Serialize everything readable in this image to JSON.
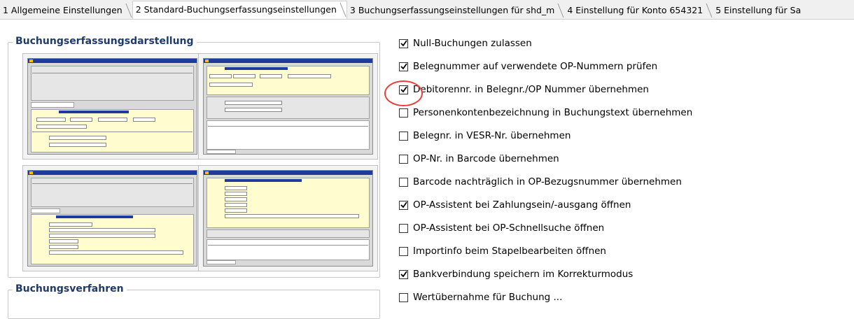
{
  "tabs": [
    {
      "label": "1 Allgemeine Einstellungen",
      "active": false
    },
    {
      "label": "2 Standard-Buchungserfassungseinstellungen",
      "active": true
    },
    {
      "label": "3 Buchungserfassungseinstellungen für shd_m",
      "active": false
    },
    {
      "label": "4 Einstellung für Konto 654321",
      "active": false
    },
    {
      "label": "5 Einstellung für Sa",
      "active": false
    }
  ],
  "left": {
    "group1_title": "Buchungserfassungsdarstellung",
    "group2_title": "Buchungsverfahren"
  },
  "options": [
    {
      "label": "Null-Buchungen zulassen",
      "checked": true
    },
    {
      "label": "Belegnummer auf verwendete OP-Nummern prüfen",
      "checked": true
    },
    {
      "label": "Debitorennr. in Belegnr./OP Nummer übernehmen",
      "checked": true
    },
    {
      "label": "Personenkontenbezeichnung in Buchungstext übernehmen",
      "checked": false
    },
    {
      "label": "Belegnr. in VESR-Nr. übernehmen",
      "checked": false
    },
    {
      "label": "OP-Nr. in Barcode übernehmen",
      "checked": false
    },
    {
      "label": "Barcode nachträglich in OP-Bezugsnummer übernehmen",
      "checked": false
    },
    {
      "label": "OP-Assistent bei Zahlungsein/-ausgang öffnen",
      "checked": true
    },
    {
      "label": "OP-Assistent bei OP-Schnellsuche öffnen",
      "checked": false
    },
    {
      "label": "Importinfo beim Stapelbearbeiten öffnen",
      "checked": false
    },
    {
      "label": "Bankverbindung speichern im Korrekturmodus",
      "checked": true
    },
    {
      "label": "Wertübernahme für Buchung ...",
      "checked": false
    }
  ],
  "colors": {
    "accent": "#1f3a6b",
    "highlight": "#e8403a"
  }
}
